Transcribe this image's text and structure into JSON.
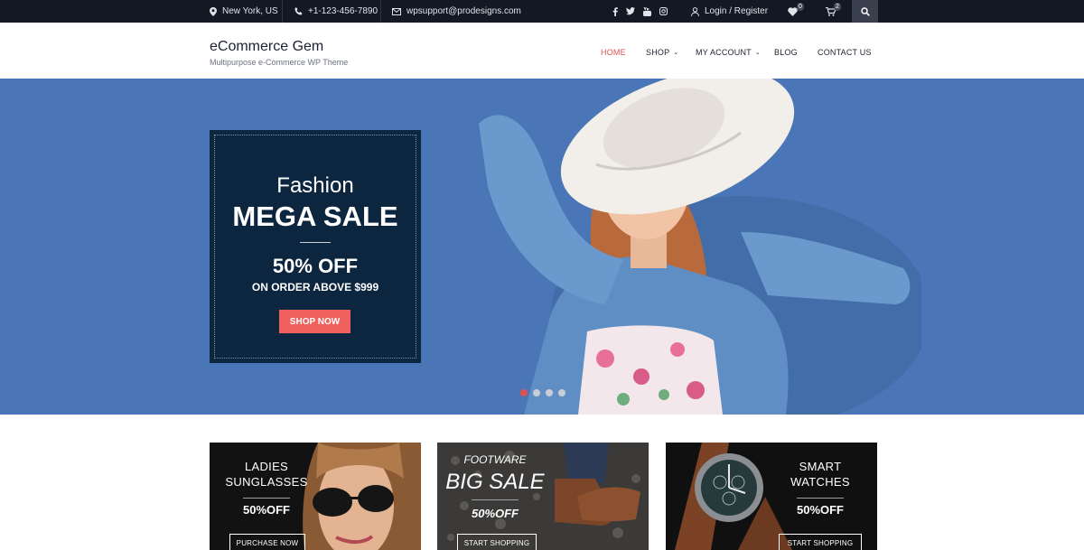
{
  "topbar": {
    "location": "New York, US",
    "phone": "+1-123-456-7890",
    "email": "wpsupport@prodesigns.com",
    "login": "Login / Register",
    "wishlist_count": "0",
    "cart_count": "2",
    "social_icons": [
      "facebook-icon",
      "twitter-icon",
      "youtube-icon",
      "instagram-icon"
    ]
  },
  "header": {
    "site_title": "eCommerce Gem",
    "tagline": "Multipurpose e-Commerce WP Theme",
    "nav": [
      {
        "label": "HOME",
        "active": true
      },
      {
        "label": "SHOP",
        "has_dropdown": true
      },
      {
        "label": "MY ACCOUNT",
        "has_dropdown": true
      },
      {
        "label": "BLOG"
      },
      {
        "label": "CONTACT US"
      }
    ]
  },
  "hero": {
    "line1": "Fashion",
    "line2": "MEGA SALE",
    "discount": "50% OFF",
    "condition": "ON ORDER ABOVE $999",
    "button": "SHOP NOW",
    "slides": 4,
    "active_slide": 0,
    "colors": {
      "background": "#4a76b8",
      "panel": "#0d2640",
      "accent": "#f0605d"
    }
  },
  "cards": [
    {
      "title_line1": "LADIES",
      "title_line2": "SUNGLASSES",
      "discount": "50%OFF",
      "button": "PURCHASE NOW"
    },
    {
      "subtitle": "FOOTWARE",
      "title": "BIG SALE",
      "discount": "50%OFF",
      "button": "START SHOPPING"
    },
    {
      "title_line1": "SMART",
      "title_line2": "WATCHES",
      "discount": "50%OFF",
      "button": "START SHOPPING"
    }
  ]
}
